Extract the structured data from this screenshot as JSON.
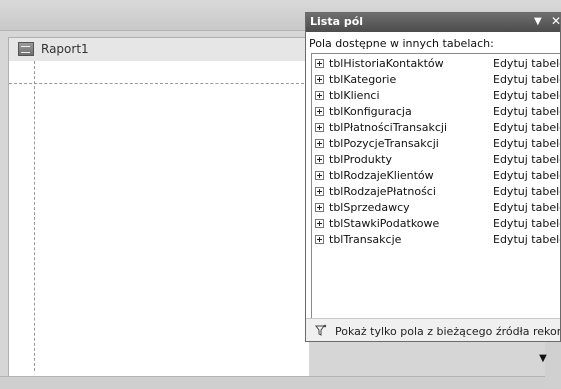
{
  "document": {
    "tab_label": "Raport1",
    "tab_icon": "report-icon"
  },
  "field_list": {
    "title": "Lista pól",
    "menu_icon": "dropdown-arrow-icon",
    "close_icon": "close-icon",
    "section_label": "Pola dostępne w innych tabelach:",
    "tables": [
      {
        "name": "tblHistoriaKontaktów",
        "action": "Edytuj tabelę"
      },
      {
        "name": "tblKategorie",
        "action": "Edytuj tabelę"
      },
      {
        "name": "tblKlienci",
        "action": "Edytuj tabelę"
      },
      {
        "name": "tblKonfiguracja",
        "action": "Edytuj tabelę"
      },
      {
        "name": "tblPłatnościTransakcji",
        "action": "Edytuj tabelę"
      },
      {
        "name": "tblPozycjeTransakcji",
        "action": "Edytuj tabelę"
      },
      {
        "name": "tblProdukty",
        "action": "Edytuj tabelę"
      },
      {
        "name": "tblRodzajeKlientów",
        "action": "Edytuj tabelę"
      },
      {
        "name": "tblRodzajePłatności",
        "action": "Edytuj tabelę"
      },
      {
        "name": "tblSprzedawcy",
        "action": "Edytuj tabelę"
      },
      {
        "name": "tblStawkiPodatkowe",
        "action": "Edytuj tabelę"
      },
      {
        "name": "tblTransakcje",
        "action": "Edytuj tabelę"
      }
    ],
    "footer_label": "Pokaż tylko pola z bieżącego źródła rekordów",
    "footer_icon": "filter-icon"
  },
  "scroll_icon": "scroll-down-arrow-icon"
}
